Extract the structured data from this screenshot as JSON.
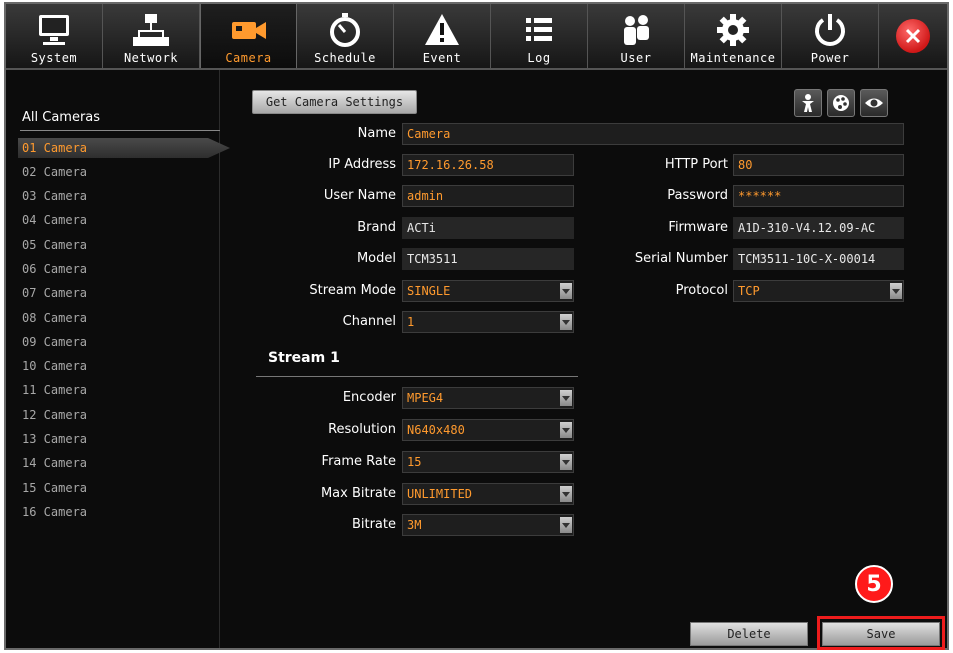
{
  "menu": {
    "tabs": [
      {
        "label": "System",
        "icon": "monitor-icon"
      },
      {
        "label": "Network",
        "icon": "network-icon"
      },
      {
        "label": "Camera",
        "icon": "camera-icon",
        "active": true
      },
      {
        "label": "Schedule",
        "icon": "stopwatch-icon"
      },
      {
        "label": "Event",
        "icon": "warning-icon"
      },
      {
        "label": "Log",
        "icon": "list-icon"
      },
      {
        "label": "User",
        "icon": "users-icon"
      },
      {
        "label": "Maintenance",
        "icon": "gear-icon"
      },
      {
        "label": "Power",
        "icon": "power-icon"
      }
    ],
    "close_icon": "close-icon"
  },
  "sidebar": {
    "title": "All Cameras",
    "cameras": [
      "01 Camera",
      "02 Camera",
      "03 Camera",
      "04 Camera",
      "05 Camera",
      "06 Camera",
      "07 Camera",
      "08 Camera",
      "09 Camera",
      "10 Camera",
      "11 Camera",
      "12 Camera",
      "13 Camera",
      "14 Camera",
      "15 Camera",
      "16 Camera"
    ],
    "selected_index": 0
  },
  "toolbar": {
    "get_settings_label": "Get Camera Settings",
    "icons": [
      "person-icon",
      "palette-icon",
      "eye-icon"
    ]
  },
  "form": {
    "name": {
      "label": "Name",
      "value": "Camera"
    },
    "ip_address": {
      "label": "IP Address",
      "value": "172.16.26.58"
    },
    "user_name": {
      "label": "User Name",
      "value": "admin"
    },
    "brand": {
      "label": "Brand",
      "value": "ACTi"
    },
    "model": {
      "label": "Model",
      "value": "TCM3511"
    },
    "stream_mode": {
      "label": "Stream Mode",
      "value": "SINGLE"
    },
    "channel": {
      "label": "Channel",
      "value": "1"
    },
    "http_port": {
      "label": "HTTP Port",
      "value": "80"
    },
    "password": {
      "label": "Password",
      "value": "******"
    },
    "firmware": {
      "label": "Firmware",
      "value": "A1D-310-V4.12.09-AC"
    },
    "serial_number": {
      "label": "Serial Number",
      "value": "TCM3511-10C-X-00014"
    },
    "protocol": {
      "label": "Protocol",
      "value": "TCP"
    }
  },
  "stream": {
    "title": "Stream 1",
    "encoder": {
      "label": "Encoder",
      "value": "MPEG4"
    },
    "resolution": {
      "label": "Resolution",
      "value": "N640x480"
    },
    "frame_rate": {
      "label": "Frame Rate",
      "value": "15"
    },
    "max_bitrate": {
      "label": "Max Bitrate",
      "value": "UNLIMITED"
    },
    "bitrate": {
      "label": "Bitrate",
      "value": "3M"
    }
  },
  "actions": {
    "delete_label": "Delete",
    "save_label": "Save",
    "step_badge": "5"
  },
  "colors": {
    "accent": "#ff9a2e",
    "highlight": "#ee1c1c"
  }
}
